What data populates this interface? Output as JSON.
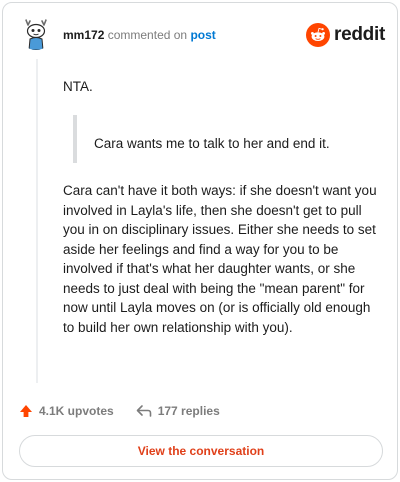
{
  "header": {
    "username": "mm172",
    "action_text": "commented on",
    "post_link": "post",
    "brand": "reddit"
  },
  "comment": {
    "paragraph_1": "NTA.",
    "quote": "Cara wants me to talk to her and end it.",
    "paragraph_2": "Cara can't have it both ways: if she doesn't want you involved in Layla's life, then she doesn't get to pull you in on disciplinary issues. Either she needs to set aside her feelings and find a way for you to be involved if that's what her daughter wants, or she needs to just deal with being the \"mean parent\" for now until Layla moves on (or is officially old enough to build her own relationship with you)."
  },
  "footer": {
    "upvotes": "4.1K upvotes",
    "replies": "177 replies",
    "view_button": "View the conversation"
  },
  "colors": {
    "accent": "#ff4500",
    "link": "#0079d3",
    "button_text": "#e0401a",
    "muted": "#7c7c7c"
  },
  "icons": {
    "avatar": "snoo-avatar-icon",
    "logo": "reddit-snoo-icon",
    "upvote": "upvote-arrow-icon",
    "reply": "reply-arrow-icon"
  }
}
